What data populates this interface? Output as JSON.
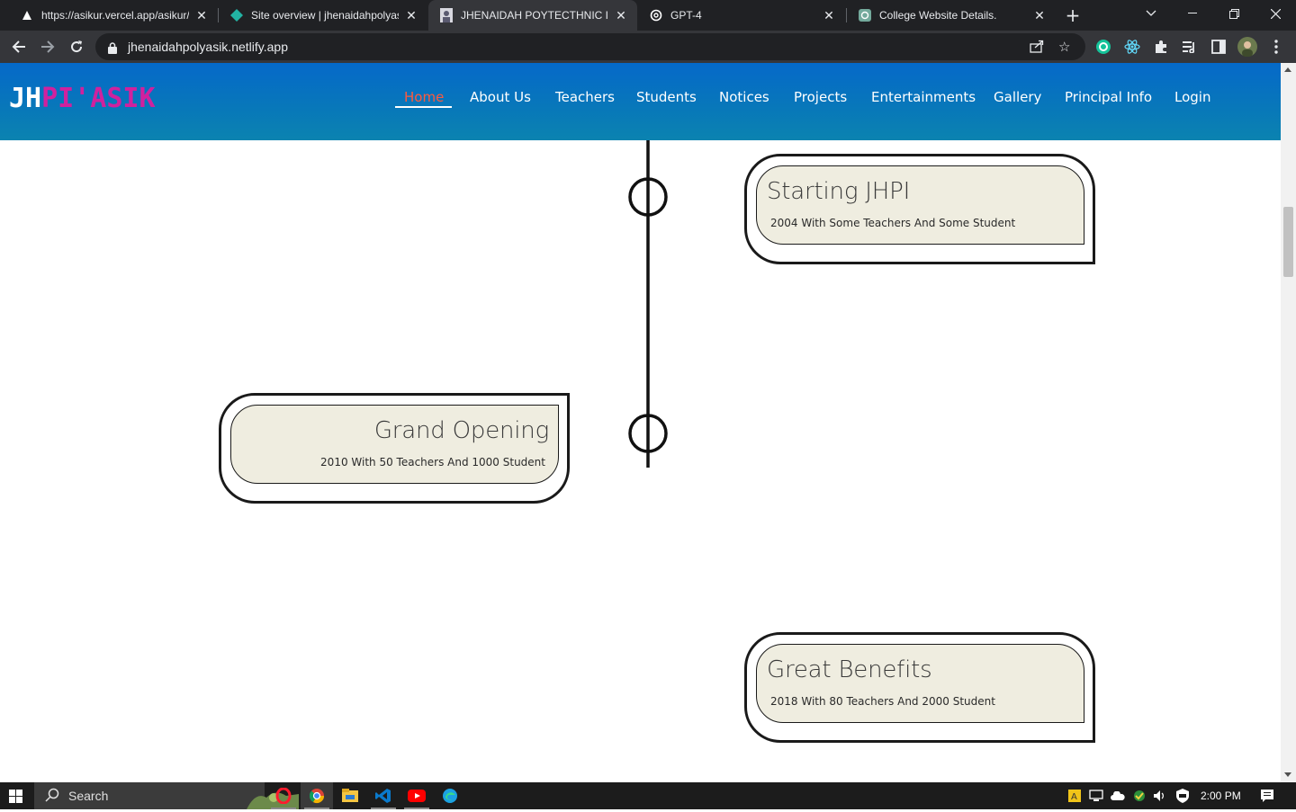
{
  "browser": {
    "tabs": [
      {
        "title": "https://asikur.vercel.app/asikur/",
        "icon": "vercel-triangle-icon",
        "active": false
      },
      {
        "title": "Site overview | jhenaidahpolyasik",
        "icon": "netlify-diamond-icon",
        "active": false
      },
      {
        "title": "JHENAIDAH POYTECTHNIC INSTITUTE",
        "icon": "site-favicon-icon",
        "active": true
      },
      {
        "title": "GPT-4",
        "icon": "openai-icon",
        "active": false
      },
      {
        "title": "College Website Details.",
        "icon": "chatgpt-icon",
        "active": false
      }
    ],
    "close_glyph": "✕",
    "new_tab_glyph": "+",
    "url": "jhenaidahpolyasik.netlify.app"
  },
  "site": {
    "logo": {
      "part1": "JH",
      "part2": "PI'ASIK",
      "color1": "#ffffff",
      "color2": "#d0219e"
    },
    "nav": [
      {
        "label": "Home",
        "active": true
      },
      {
        "label": "About Us",
        "active": false
      },
      {
        "label": "Teachers",
        "active": false
      },
      {
        "label": "Students",
        "active": false
      },
      {
        "label": "Notices",
        "active": false
      },
      {
        "label": "Projects",
        "active": false
      },
      {
        "label": "Entertainments",
        "active": false
      },
      {
        "label": "Gallery",
        "active": false
      },
      {
        "label": "Principal Info",
        "active": false
      },
      {
        "label": "Login",
        "active": false
      }
    ],
    "nav_active_color": "#ff5a3c",
    "nav_gradient": [
      "#0569c9",
      "#0b83b0"
    ]
  },
  "timeline": {
    "events": [
      {
        "title": "Starting JHPI",
        "description": "2004 With Some Teachers And Some Student",
        "side": "right"
      },
      {
        "title": "Grand Opening",
        "description": "2010 With 50 Teachers And 1000 Student",
        "side": "left"
      },
      {
        "title": "Great Benefits",
        "description": "2018 With 80 Teachers And 2000 Student",
        "side": "right"
      }
    ],
    "card_fill": "#efede0"
  },
  "taskbar": {
    "search_label": "Search",
    "time": "2:00 PM",
    "apps": [
      "opera-icon",
      "chrome-icon",
      "file-explorer-icon",
      "vscode-icon",
      "youtube-icon",
      "edge-icon"
    ],
    "tray": [
      "font-icon",
      "network-icon",
      "onedrive-icon",
      "security-icon",
      "volume-icon",
      "defender-icon"
    ]
  }
}
